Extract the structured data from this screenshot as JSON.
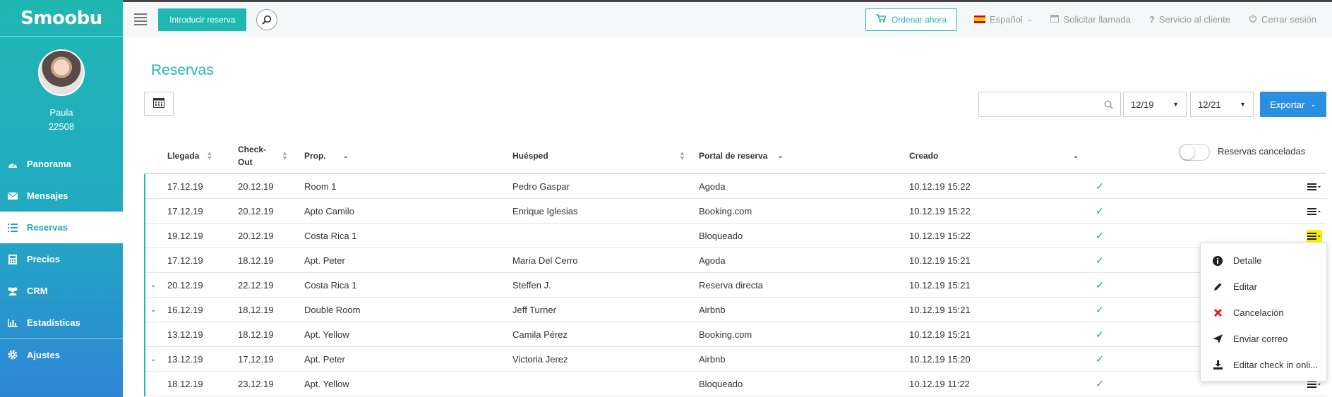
{
  "sidebar": {
    "logo": "Smoobu",
    "user_name": "Paula",
    "user_id": "22508",
    "items": [
      {
        "label": "Panorama",
        "icon": "dashboard-icon"
      },
      {
        "label": "Mensajes",
        "icon": "envelope-icon"
      },
      {
        "label": "Reservas",
        "icon": "list-icon"
      },
      {
        "label": "Precios",
        "icon": "calculator-icon"
      },
      {
        "label": "CRM",
        "icon": "users-icon"
      },
      {
        "label": "Estadísticas",
        "icon": "bar-chart-icon"
      },
      {
        "label": "Ajustes",
        "icon": "gear-icon"
      }
    ],
    "active_index": 2
  },
  "topbar": {
    "new_booking_label": "Introducir reserva",
    "order_label": "Ordenar ahora",
    "language_label": "Español",
    "request_call_label": "Solicitar llamada",
    "support_label": "Servicio al cliente",
    "logout_label": "Cerrar sesión"
  },
  "main": {
    "title": "Reservas",
    "date_from": "12/19",
    "date_to": "12/21",
    "export_label": "Exportar",
    "search_value": "",
    "cancelled_toggle_label": "Reservas canceladas"
  },
  "table": {
    "headers": {
      "arrival": "Llegada",
      "checkout_line1": "Check-",
      "checkout_line2": "Out",
      "property": "Prop.",
      "guest": "Huésped",
      "portal": "Portal de reserva",
      "created": "Creado"
    },
    "rows": [
      {
        "arrival": "17.12.19",
        "checkout": "20.12.19",
        "property": "Room 1",
        "guest": "Pedro Gaspar",
        "portal": "Agoda",
        "created": "10.12.19 15:22",
        "check": "✓",
        "expandable": false
      },
      {
        "arrival": "17.12.19",
        "checkout": "20.12.19",
        "property": "Apto Camilo",
        "guest": "Enrique Iglesias",
        "portal": "Booking.com",
        "created": "10.12.19 15:22",
        "check": "✓",
        "expandable": false
      },
      {
        "arrival": "19.12.19",
        "checkout": "20.12.19",
        "property": "Costa Rica 1",
        "guest": "",
        "portal": "Bloqueado",
        "created": "10.12.19 15:22",
        "check": "✓",
        "expandable": false
      },
      {
        "arrival": "17.12.19",
        "checkout": "18.12.19",
        "property": "Apt. Peter",
        "guest": "María Del Cerro",
        "portal": "Agoda",
        "created": "10.12.19 15:21",
        "check": "✓",
        "expandable": false
      },
      {
        "arrival": "20.12.19",
        "checkout": "22.12.19",
        "property": "Costa Rica 1",
        "guest": "Steffen J.",
        "portal": "Reserva directa",
        "created": "10.12.19 15:21",
        "check": "✓",
        "expandable": true
      },
      {
        "arrival": "16.12.19",
        "checkout": "18.12.19",
        "property": "Double Room",
        "guest": "Jeff Turner",
        "portal": "Airbnb",
        "created": "10.12.19 15:21",
        "check": "✓",
        "expandable": true
      },
      {
        "arrival": "13.12.19",
        "checkout": "18.12.19",
        "property": "Apt. Yellow",
        "guest": "Camila Pérez",
        "portal": "Booking.com",
        "created": "10.12.19 15:21",
        "check": "✓",
        "expandable": false
      },
      {
        "arrival": "13.12.19",
        "checkout": "17.12.19",
        "property": "Apt. Peter",
        "guest": "Victoria Jerez",
        "portal": "Airbnb",
        "created": "10.12.19 15:20",
        "check": "✓",
        "expandable": true
      },
      {
        "arrival": "18.12.19",
        "checkout": "23.12.19",
        "property": "Apt. Yellow",
        "guest": "",
        "portal": "Bloqueado",
        "created": "10.12.19 11:22",
        "check": "✓",
        "expandable": false
      }
    ],
    "highlighted_menu_row": 2
  },
  "dropdown": {
    "items": [
      {
        "label": "Detalle",
        "icon": "info-icon"
      },
      {
        "label": "Editar",
        "icon": "pencil-icon"
      },
      {
        "label": "Cancelación",
        "icon": "cancel-x-icon"
      },
      {
        "label": "Enviar correo",
        "icon": "send-icon"
      },
      {
        "label": "Editar check in onli...",
        "icon": "download-icon"
      }
    ]
  },
  "colors": {
    "teal": "#1fb7b2",
    "blue": "#2a8fe0",
    "check_green": "#3aa845",
    "highlight": "#f7f400",
    "cancel_red": "#e02020"
  }
}
